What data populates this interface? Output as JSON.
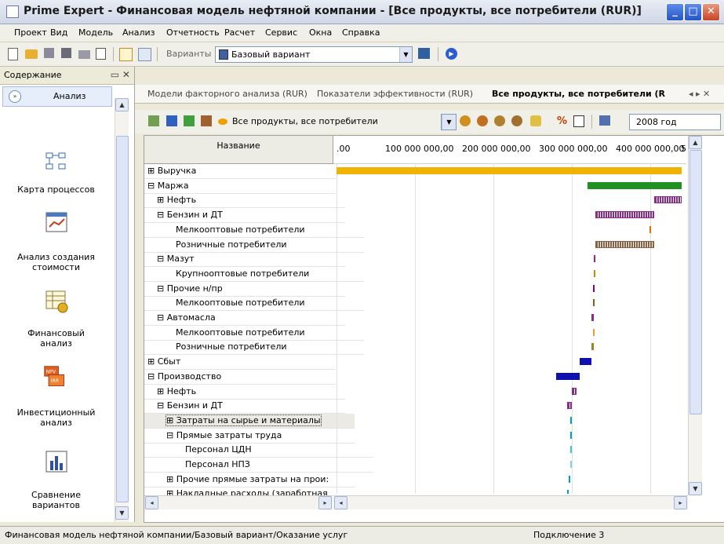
{
  "window": {
    "title": "Prime Expert - Финансовая модель нефтяной компании - [Все продукты, все потребители (RUR)]",
    "min_glyph": "_",
    "max_glyph": "□",
    "close_glyph": "✕"
  },
  "menu": [
    "Проект",
    "Вид",
    "Модель",
    "Анализ",
    "Отчетность",
    "Расчет",
    "Сервис",
    "Окна",
    "Справка"
  ],
  "toolbar": {
    "variants_label": "Варианты",
    "variant_value": "Базовый вариант"
  },
  "leftpanel": {
    "header": "Содержание",
    "header_controls": "▭ ✕",
    "group_label": "Анализ",
    "items": [
      {
        "label_lines": [
          "Карта процессов"
        ],
        "icon": "process-map-icon"
      },
      {
        "label_lines": [
          "Анализ создания",
          "стоимости"
        ],
        "icon": "value-creation-icon"
      },
      {
        "label_lines": [
          "Финансовый",
          "анализ"
        ],
        "icon": "financial-analysis-icon"
      },
      {
        "label_lines": [
          "Инвестиционный",
          "анализ"
        ],
        "icon": "investment-analysis-icon"
      },
      {
        "label_lines": [
          "Сравнение",
          "вариантов"
        ],
        "icon": "compare-variants-icon"
      }
    ],
    "npv_label": "NPV",
    "irr_label": "IRR"
  },
  "tabs": [
    {
      "label": "Модели факторного анализа (RUR)",
      "active": false
    },
    {
      "label": "Показатели эффективности (RUR)",
      "active": false
    },
    {
      "label": "Все продукты, все потребители (R",
      "active": true
    }
  ],
  "tab_nav": "◂ ▸ ✕",
  "grid_toolbar": {
    "scope_value": "Все продукты, все потребители",
    "year_value": "2008 год",
    "percent_label": "%"
  },
  "grid": {
    "name_header": "Название",
    "axis_ticks": [
      ".00",
      "100 000 000,00",
      "200 000 000,00",
      "300 000 000,00",
      "400 000 000,00",
      "5"
    ],
    "rows": [
      {
        "label": "⊞ Выручка",
        "indent": 1
      },
      {
        "label": "⊟ Маржа",
        "indent": 1
      },
      {
        "label": "⊞ Нефть",
        "indent": 2
      },
      {
        "label": "⊟ Бензин и ДТ",
        "indent": 2
      },
      {
        "label": "Мелкооптовые потребители",
        "indent": 4
      },
      {
        "label": "Розничные потребители",
        "indent": 4
      },
      {
        "label": "⊟ Мазут",
        "indent": 2
      },
      {
        "label": "Крупнооптовые потребители",
        "indent": 4
      },
      {
        "label": "⊟ Прочие н/пр",
        "indent": 2
      },
      {
        "label": "Мелкооптовые потребители",
        "indent": 4
      },
      {
        "label": "⊟ Автомасла",
        "indent": 2
      },
      {
        "label": "Мелкооптовые потребители",
        "indent": 4
      },
      {
        "label": "Розничные потребители",
        "indent": 4
      },
      {
        "label": "⊞ Сбыт",
        "indent": 1
      },
      {
        "label": "⊟ Производство",
        "indent": 1
      },
      {
        "label": "⊞ Нефть",
        "indent": 2
      },
      {
        "label": "⊟ Бензин и ДТ",
        "indent": 2
      },
      {
        "label": "⊞ Затраты на сырье и материалы",
        "indent": 3,
        "selected": true
      },
      {
        "label": "⊟ Прямые затраты труда",
        "indent": 3
      },
      {
        "label": "Персонал ЦДН",
        "indent": 5
      },
      {
        "label": "Персонал НПЗ",
        "indent": 5
      },
      {
        "label": "⊞ Прочие прямые затраты на прои:",
        "indent": 3
      },
      {
        "label": "⊞ Накладные расходы (заработная",
        "indent": 3
      }
    ]
  },
  "chart_data": {
    "type": "bar",
    "orientation": "horizontal-waterfall",
    "xlim": [
      0,
      440000000
    ],
    "bars": [
      {
        "row": 0,
        "start": 0,
        "end": 440000000,
        "color": "#f0b400",
        "pattern": "solid"
      },
      {
        "row": 1,
        "start": 320000000,
        "end": 440000000,
        "color": "#209020",
        "pattern": "solid"
      },
      {
        "row": 2,
        "start": 405000000,
        "end": 440000000,
        "color": "#8a2a8a",
        "pattern": "hatched"
      },
      {
        "row": 3,
        "start": 330000000,
        "end": 405000000,
        "color": "#8a2a8a",
        "pattern": "hatched"
      },
      {
        "row": 4,
        "start": 399000000,
        "end": 401000000,
        "color": "#e07000",
        "pattern": "solid"
      },
      {
        "row": 5,
        "start": 330000000,
        "end": 405000000,
        "color": "#8a6040",
        "pattern": "hatched"
      },
      {
        "row": 6,
        "start": 328000000,
        "end": 330000000,
        "color": "#a0208a",
        "pattern": "solid"
      },
      {
        "row": 7,
        "start": 328000000,
        "end": 330000000,
        "color": "#e08000",
        "pattern": "solid"
      },
      {
        "row": 8,
        "start": 327000000,
        "end": 329000000,
        "color": "#800080",
        "pattern": "solid"
      },
      {
        "row": 9,
        "start": 327000000,
        "end": 329000000,
        "color": "#806020",
        "pattern": "solid"
      },
      {
        "row": 10,
        "start": 325000000,
        "end": 328000000,
        "color": "#8a2a8a",
        "pattern": "hatched"
      },
      {
        "row": 11,
        "start": 327000000,
        "end": 329000000,
        "color": "#e0a040",
        "pattern": "solid"
      },
      {
        "row": 12,
        "start": 325000000,
        "end": 328000000,
        "color": "#a08020",
        "pattern": "hatched"
      },
      {
        "row": 13,
        "start": 310000000,
        "end": 325000000,
        "color": "#1010b0",
        "pattern": "solid"
      },
      {
        "row": 14,
        "start": 280000000,
        "end": 310000000,
        "color": "#1010b0",
        "pattern": "solid"
      },
      {
        "row": 15,
        "start": 300000000,
        "end": 306000000,
        "color": "#8a2a8a",
        "pattern": "hatched"
      },
      {
        "row": 16,
        "start": 294000000,
        "end": 300000000,
        "color": "#8a2a8a",
        "pattern": "hatched"
      },
      {
        "row": 17,
        "start": 298000000,
        "end": 300000000,
        "color": "#00a0c0",
        "pattern": "solid"
      },
      {
        "row": 18,
        "start": 298000000,
        "end": 299000000,
        "color": "#00a0c0",
        "pattern": "solid"
      },
      {
        "row": 19,
        "start": 298000000,
        "end": 299000000,
        "color": "#40c0e0",
        "pattern": "solid"
      },
      {
        "row": 20,
        "start": 298000000,
        "end": 299000000,
        "color": "#80d0f0",
        "pattern": "solid"
      },
      {
        "row": 21,
        "start": 296000000,
        "end": 298000000,
        "color": "#00a0c0",
        "pattern": "solid"
      },
      {
        "row": 22,
        "start": 294000000,
        "end": 296000000,
        "color": "#00a0c0",
        "pattern": "solid"
      }
    ]
  },
  "status": {
    "path": "Финансовая модель нефтяной компании/Базовый вариант/Оказание услуг",
    "connection": "Подключение 3"
  }
}
